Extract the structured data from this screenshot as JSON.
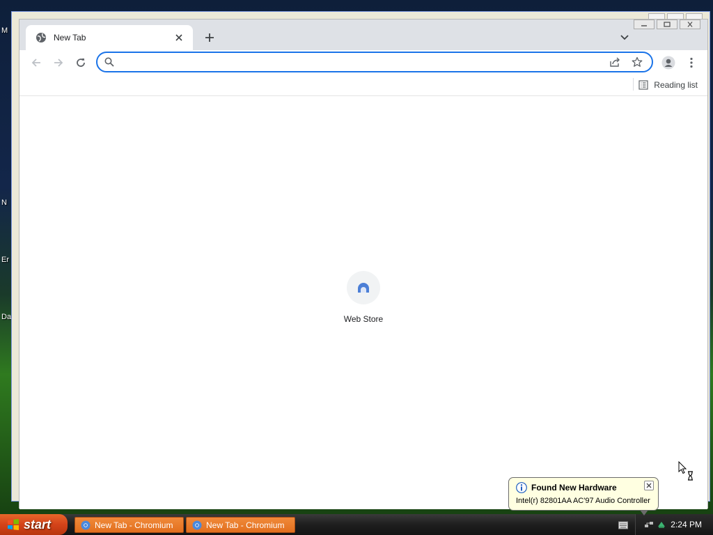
{
  "desktop": {
    "labels": [
      "M",
      "N",
      "Er",
      "Da"
    ]
  },
  "browser": {
    "tab": {
      "title": "New Tab",
      "favicon_icon": "globe-icon",
      "close_icon": "close-icon"
    },
    "new_tab_icon": "plus-icon",
    "tab_search_icon": "chevron-down-icon",
    "window_controls": [
      "minimize-icon",
      "restore-icon",
      "close-icon"
    ],
    "toolbar": {
      "back_icon": "arrow-left-icon",
      "forward_icon": "arrow-right-icon",
      "reload_icon": "reload-icon",
      "omnibox": {
        "value": "",
        "placeholder": "",
        "search_icon": "search-icon",
        "share_icon": "share-icon",
        "bookmark_icon": "star-icon"
      },
      "profile_icon": "person-icon",
      "menu_icon": "kebab-menu-icon"
    },
    "bookmark_bar": {
      "reading_list_label": "Reading list",
      "reading_list_icon": "reading-list-icon"
    },
    "new_tab_page": {
      "shortcuts": [
        {
          "label": "Web Store",
          "icon": "web-store-icon"
        }
      ]
    },
    "colors": {
      "accent": "#1a73e8",
      "tabstrip": "#dee1e6"
    }
  },
  "taskbar": {
    "start_label": "start",
    "tasks": [
      {
        "label": "New Tab - Chromium",
        "icon": "chromium-icon"
      },
      {
        "label": "New Tab - Chromium",
        "icon": "chromium-icon"
      }
    ],
    "clock": "2:24 PM",
    "tray_icons": [
      "keyboard-icon",
      "network-icon",
      "safely-remove-icon"
    ]
  },
  "notification": {
    "title": "Found New Hardware",
    "message": "Intel(r) 82801AA AC'97 Audio Controller",
    "icon": "info-icon"
  }
}
